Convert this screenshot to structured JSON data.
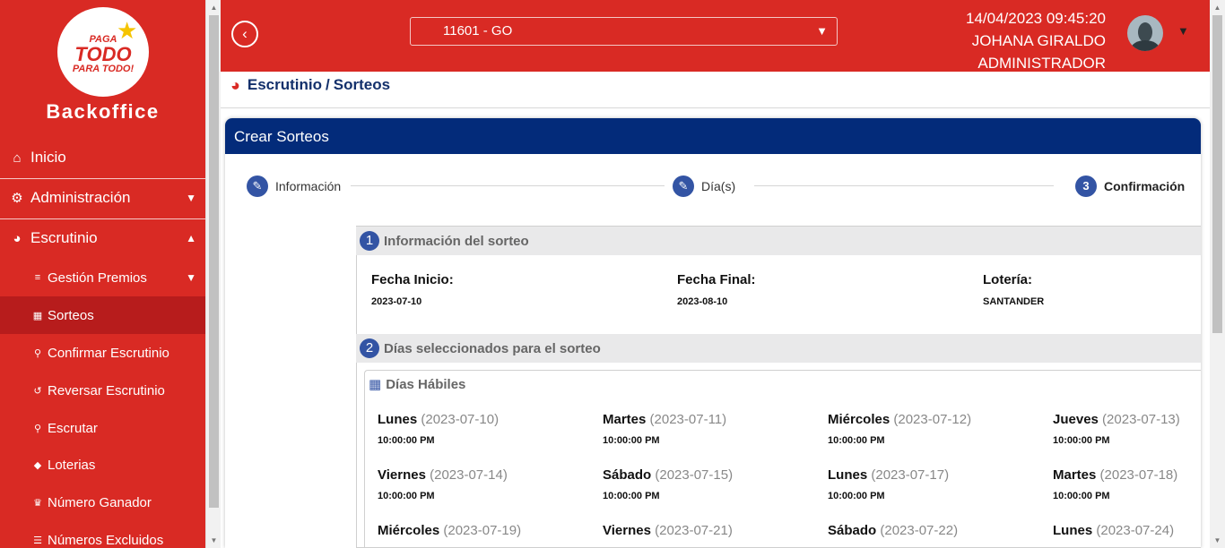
{
  "sidebar": {
    "brand": "Backoffice",
    "logo": {
      "line1": "PAGA",
      "line2": "TODO",
      "line3": "PARA TODO!"
    },
    "items": [
      {
        "label": "Inicio",
        "icon": "home-icon"
      },
      {
        "label": "Administración",
        "icon": "gear-icon"
      },
      {
        "label": "Escrutinio",
        "icon": "pie-chart-icon"
      }
    ],
    "subitems": [
      {
        "label": "Gestión Premios",
        "icon": "sliders-icon"
      },
      {
        "label": "Sorteos",
        "icon": "calendar-icon",
        "active": true
      },
      {
        "label": "Confirmar Escrutinio",
        "icon": "search-icon"
      },
      {
        "label": "Reversar Escrutinio",
        "icon": "undo-icon"
      },
      {
        "label": "Escrutar",
        "icon": "search-icon"
      },
      {
        "label": "Loterias",
        "icon": "ticket-icon"
      },
      {
        "label": "Número Ganador",
        "icon": "trophy-icon"
      },
      {
        "label": "Números Excluidos",
        "icon": "list-icon"
      }
    ]
  },
  "header": {
    "selected_office": "11601 - GO",
    "datetime": "14/04/2023 09:45:20",
    "user_name": "JOHANA GIRALDO",
    "role": "ADMINISTRADOR"
  },
  "breadcrumb": {
    "section": "Escrutinio",
    "page": "Sorteos",
    "separator": "/"
  },
  "card": {
    "title": "Crear Sorteos",
    "steps": [
      {
        "label": "Información",
        "marker": "✎"
      },
      {
        "label": "Día(s)",
        "marker": "✎"
      },
      {
        "label": "Confirmación",
        "marker": "3"
      }
    ],
    "info_section": {
      "number": "1",
      "title": "Información del sorteo",
      "fields": [
        {
          "label": "Fecha Inicio:",
          "value": "2023-07-10"
        },
        {
          "label": "Fecha Final:",
          "value": "2023-08-10"
        },
        {
          "label": "Lotería:",
          "value": "SANTANDER"
        }
      ]
    },
    "days_section": {
      "number": "2",
      "title": "Días seleccionados para el sorteo",
      "subtitle": "Días Hábiles",
      "days": [
        {
          "name": "Lunes",
          "date": "(2023-07-10)",
          "time": "10:00:00 PM"
        },
        {
          "name": "Martes",
          "date": "(2023-07-11)",
          "time": "10:00:00 PM"
        },
        {
          "name": "Miércoles",
          "date": "(2023-07-12)",
          "time": "10:00:00 PM"
        },
        {
          "name": "Jueves",
          "date": "(2023-07-13)",
          "time": "10:00:00 PM"
        },
        {
          "name": "Viernes",
          "date": "(2023-07-14)",
          "time": "10:00:00 PM"
        },
        {
          "name": "Sábado",
          "date": "(2023-07-15)",
          "time": "10:00:00 PM"
        },
        {
          "name": "Lunes",
          "date": "(2023-07-17)",
          "time": "10:00:00 PM"
        },
        {
          "name": "Martes",
          "date": "(2023-07-18)",
          "time": "10:00:00 PM"
        },
        {
          "name": "Miércoles",
          "date": "(2023-07-19)",
          "time": ""
        },
        {
          "name": "Viernes",
          "date": "(2023-07-21)",
          "time": ""
        },
        {
          "name": "Sábado",
          "date": "(2023-07-22)",
          "time": ""
        },
        {
          "name": "Lunes",
          "date": "(2023-07-24)",
          "time": ""
        }
      ]
    }
  },
  "colors": {
    "primary_red": "#d92a24",
    "navy": "#032b7a",
    "step_blue": "#3354a4"
  }
}
